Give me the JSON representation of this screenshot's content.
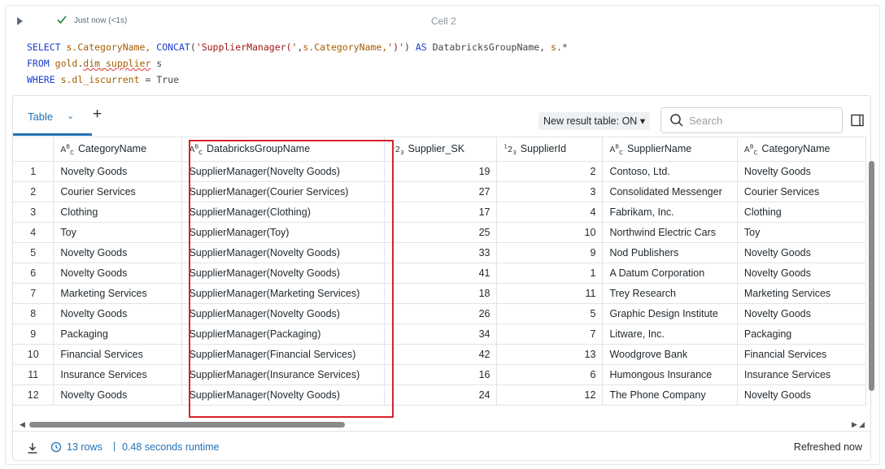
{
  "cell": {
    "status": "Just now (<1s)",
    "title": "Cell 2"
  },
  "code": {
    "line1": {
      "kw_select": "SELECT",
      "a": "s",
      "b": ".CategoryName, ",
      "fn": "CONCAT",
      "c": "(",
      "s1": "'SupplierManager('",
      "d": ",",
      "e": "s",
      "f": ".CategoryName,",
      "s2": "')'",
      "g": ") ",
      "kw_as": "AS",
      "h": " DatabricksGroupName, ",
      "i": "s",
      "j": ".*"
    },
    "line2": {
      "kw_from": "FROM",
      "schema": "gold",
      "dot": ".",
      "table": "dim_supplier",
      "alias": " s"
    },
    "line3": {
      "kw_where": "WHERE",
      "a": "s",
      "b": ".dl_iscurrent",
      "c": " = ",
      "d": "True"
    }
  },
  "results": {
    "tab_label": "Table",
    "toggle_label": "New result table: ON",
    "search_placeholder": "Search",
    "columns": [
      "",
      "CategoryName",
      "DatabricksGroupName",
      "Supplier_SK",
      "SupplierId",
      "SupplierName",
      "CategoryName"
    ],
    "column_types": [
      "",
      "string",
      "string",
      "number",
      "number",
      "string",
      "string"
    ],
    "rows": [
      [
        "1",
        "Novelty Goods",
        "SupplierManager(Novelty Goods)",
        "19",
        "2",
        "Contoso, Ltd.",
        "Novelty Goods"
      ],
      [
        "2",
        "Courier Services",
        "SupplierManager(Courier Services)",
        "27",
        "3",
        "Consolidated Messenger",
        "Courier Services"
      ],
      [
        "3",
        "Clothing",
        "SupplierManager(Clothing)",
        "17",
        "4",
        "Fabrikam, Inc.",
        "Clothing"
      ],
      [
        "4",
        "Toy",
        "SupplierManager(Toy)",
        "25",
        "10",
        "Northwind Electric Cars",
        "Toy"
      ],
      [
        "5",
        "Novelty Goods",
        "SupplierManager(Novelty Goods)",
        "33",
        "9",
        "Nod Publishers",
        "Novelty Goods"
      ],
      [
        "6",
        "Novelty Goods",
        "SupplierManager(Novelty Goods)",
        "41",
        "1",
        "A Datum Corporation",
        "Novelty Goods"
      ],
      [
        "7",
        "Marketing Services",
        "SupplierManager(Marketing Services)",
        "18",
        "11",
        "Trey Research",
        "Marketing Services"
      ],
      [
        "8",
        "Novelty Goods",
        "SupplierManager(Novelty Goods)",
        "26",
        "5",
        "Graphic Design Institute",
        "Novelty Goods"
      ],
      [
        "9",
        "Packaging",
        "SupplierManager(Packaging)",
        "34",
        "7",
        "Litware, Inc.",
        "Packaging"
      ],
      [
        "10",
        "Financial Services",
        "SupplierManager(Financial Services)",
        "42",
        "13",
        "Woodgrove Bank",
        "Financial Services"
      ],
      [
        "11",
        "Insurance Services",
        "SupplierManager(Insurance Services)",
        "16",
        "6",
        "Humongous Insurance",
        "Insurance Services"
      ],
      [
        "12",
        "Novelty Goods",
        "SupplierManager(Novelty Goods)",
        "24",
        "12",
        "The Phone Company",
        "Novelty Goods"
      ]
    ],
    "footer": {
      "rows": "13 rows",
      "separator": "|",
      "runtime": "0.48 seconds runtime",
      "refreshed": "Refreshed now"
    }
  },
  "colors": {
    "accent": "#2272b4",
    "highlight": "#d8232a",
    "success": "#2e7d32"
  }
}
